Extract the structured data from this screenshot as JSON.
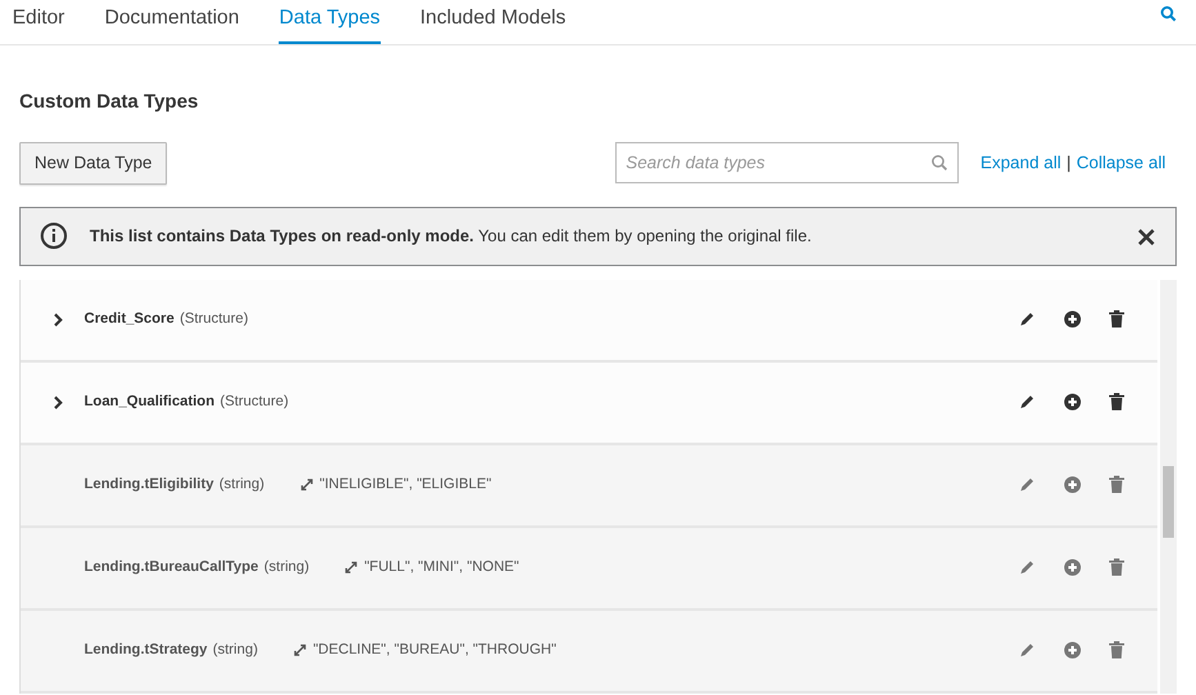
{
  "tabs": [
    {
      "label": "Editor",
      "selected": false
    },
    {
      "label": "Documentation",
      "selected": false
    },
    {
      "label": "Data Types",
      "selected": true
    },
    {
      "label": "Included Models",
      "selected": false
    }
  ],
  "heading": "Custom Data Types",
  "new_button": "New Data Type",
  "search": {
    "placeholder": "Search data types"
  },
  "links": [
    "Expand all",
    "Collapse all"
  ],
  "link_separator": "|",
  "alert": {
    "message": "**This list contains Data Types on read-only mode.** You can edit them by opening the original file."
  },
  "rows": [
    {
      "kind": "structure",
      "name": "Credit_Score",
      "type": "(Structure)",
      "expanded": false,
      "disabled": false
    },
    {
      "kind": "structure",
      "name": "Loan_Qualification",
      "type": "(Structure)",
      "expanded": false,
      "disabled": false
    },
    {
      "kind": "simple",
      "name": "Lending.tEligibility",
      "type": "(string)",
      "constraint": "\"INELIGIBLE\", \"ELIGIBLE\"",
      "disabled": true
    },
    {
      "kind": "simple",
      "name": "Lending.tBureauCallType",
      "type": "(string)",
      "constraint": "\"FULL\", \"MINI\", \"NONE\"",
      "disabled": true
    },
    {
      "kind": "simple",
      "name": "Lending.tStrategy",
      "type": "(string)",
      "constraint": "\"DECLINE\", \"BUREAU\", \"THROUGH\"",
      "disabled": true
    }
  ]
}
